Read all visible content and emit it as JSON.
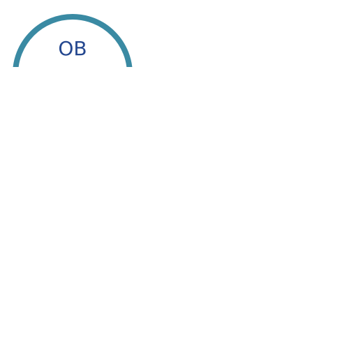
{
  "avatar": {
    "initials": "OB",
    "ring_color": "#3a8aa3",
    "text_color": "#24478f"
  }
}
